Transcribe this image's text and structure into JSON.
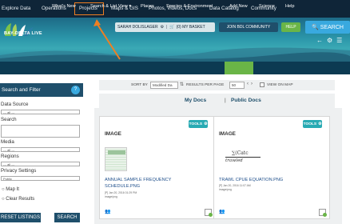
{
  "top_nav": {
    "items": [
      "Explore Data",
      "Operations",
      "Projects",
      "Maps & GIS",
      "Photos, Videos, Docs",
      "Data Catalog",
      "Community"
    ]
  },
  "header": {
    "logo_text": "BAY-DELTA LIVE",
    "user_name": "SARAH DOLISLAGER",
    "basket_label": "(0) MY BASKET",
    "join_label": "JOIN BDL COMMUNITY",
    "help_label": "HELP",
    "search_label": "SEARCH"
  },
  "sub_nav": {
    "items": [
      "What's New",
      "Search & List View",
      "Places",
      "Species & Environment",
      "Add New",
      "Science",
      "Help"
    ],
    "active": "Add New"
  },
  "sidebar": {
    "title": "Search and Filter",
    "data_source_label": "Data Source",
    "data_source_value": "--- all ---",
    "search_label": "Search",
    "media_label": "Media",
    "media_value": "--- all ---",
    "regions_label": "Regions",
    "regions_value": "--- all ---",
    "privacy_label": "Privacy Settings",
    "privacy_value": "Public",
    "map_it": "Map It",
    "clear_results": "Clear Results",
    "reset_label": "RESET LISTINGS",
    "search_button": "SEARCH"
  },
  "sort_bar": {
    "sort_by_label": "SORT BY",
    "sort_by_value": "Modified Da",
    "results_label": "RESULTS PER PAGE",
    "results_value": "50",
    "view_on_map": "VIEW ON MAP"
  },
  "tabs": {
    "my_docs": "My Docs",
    "separator": "|",
    "public_docs": "Public Docs"
  },
  "cards": [
    {
      "type": "IMAGE",
      "tools": "TOOLS",
      "title_line1": "ANNUAL SAMPLE FREQUENCY",
      "title_line2": "SCHEDULE.PNG",
      "date": "[P] Jan 20, 2016 01:29 PM",
      "mime": "image/png"
    },
    {
      "type": "IMAGE",
      "tools": "TOOLS",
      "title_line1": "TRAWL CPUE EQUATION.PNG",
      "date": "[P] Jan 20, 2016 11:07 AM",
      "mime": "image/png",
      "formula_top": "∑(Catc",
      "formula_bottom": "trawled"
    }
  ],
  "colors": {
    "top_nav_bg": "#0f2538",
    "sub_nav_bg": "#0c3a52",
    "add_new_bg": "#6ab547",
    "search_btn": "#39a9df",
    "highlight": "#ef7f22",
    "tools_btn": "#28aab3"
  }
}
